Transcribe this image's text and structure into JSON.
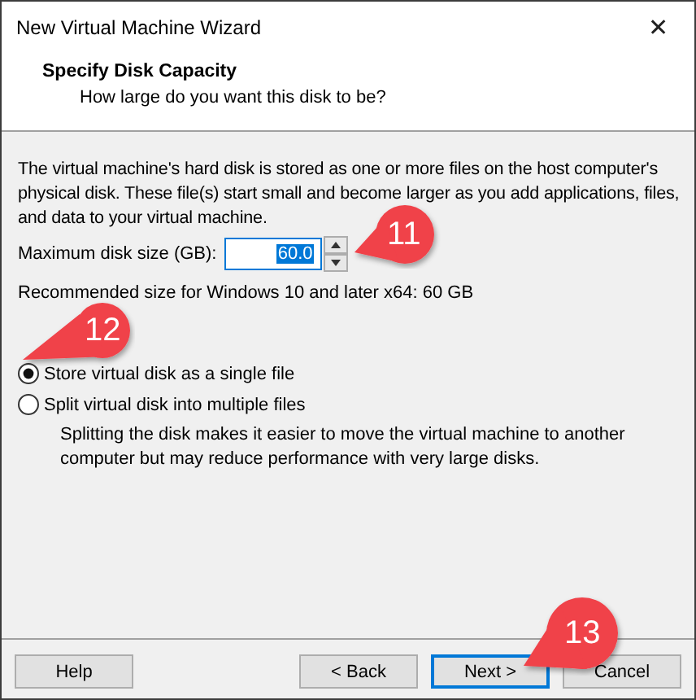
{
  "window": {
    "title": "New Virtual Machine Wizard",
    "close": "✕"
  },
  "header": {
    "title": "Specify Disk Capacity",
    "subtitle": "How large do you want this disk to be?"
  },
  "description": "The virtual machine's hard disk is stored as one or more files on the host computer's physical disk. These file(s) start small and become larger as you add applications, files, and data to your virtual machine.",
  "disk_size": {
    "label": "Maximum disk size (GB):",
    "value": "60.0",
    "text_selected": true
  },
  "recommendation": "Recommended size for Windows 10 and later x64: 60 GB",
  "storage_options": [
    {
      "label": "Store virtual disk as a single file",
      "selected": true
    },
    {
      "label": "Split virtual disk into multiple files",
      "selected": false
    }
  ],
  "split_note": "Splitting the disk makes it easier to move the virtual machine to another computer but may reduce performance with very large disks.",
  "buttons": [
    {
      "label": "Help",
      "focused": false
    },
    {
      "label": "< Back",
      "focused": false
    },
    {
      "label": "Next >",
      "focused": true
    },
    {
      "label": "Cancel",
      "focused": false
    }
  ],
  "callouts": [
    {
      "number": "11"
    },
    {
      "number": "12"
    },
    {
      "number": "13"
    }
  ]
}
